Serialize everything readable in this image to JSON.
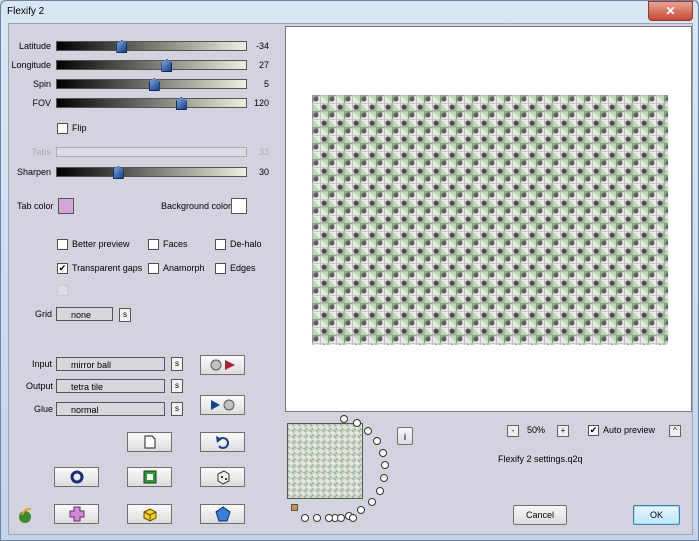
{
  "window": {
    "title": "Flexify 2",
    "close_glyph": "✕"
  },
  "sliders": [
    {
      "label": "Latitude",
      "value": "-34",
      "fraction": 0.33
    },
    {
      "label": "Longitude",
      "value": "27",
      "fraction": 0.58
    },
    {
      "label": "Spin",
      "value": "5",
      "fraction": 0.51
    },
    {
      "label": "FOV",
      "value": "120",
      "fraction": 0.66
    }
  ],
  "flip": {
    "label": "Flip",
    "checked": false
  },
  "tabs": {
    "label": "Tabs",
    "value": "33",
    "disabled": true
  },
  "sharpen": {
    "label": "Sharpen",
    "value": "30",
    "fraction": 0.31
  },
  "tab_color": {
    "label": "Tab color",
    "color": "#d5a6d9"
  },
  "background_color": {
    "label": "Background color",
    "color": "#ffffff"
  },
  "checkboxes": [
    {
      "label": "Better preview",
      "checked": false
    },
    {
      "label": "Faces",
      "checked": false
    },
    {
      "label": "De-halo",
      "checked": false
    },
    {
      "label": "Transparent gaps",
      "checked": true
    },
    {
      "label": "Anamorph",
      "checked": false
    },
    {
      "label": "Edges",
      "checked": false
    }
  ],
  "grid": {
    "label": "Grid",
    "value": "none",
    "s_label": "s"
  },
  "io": {
    "input": {
      "label": "Input",
      "value": "mirror ball",
      "s_label": "s"
    },
    "output": {
      "label": "Output",
      "value": "tetra tile",
      "s_label": "s"
    },
    "glue": {
      "label": "Glue",
      "value": "normal",
      "s_label": "s"
    }
  },
  "zoom": {
    "minus": "-",
    "value": "50%",
    "plus": "+"
  },
  "auto_preview": {
    "label": "Auto preview",
    "checked": true,
    "caret": "^"
  },
  "settings_file": "Flexify 2 settings.q2q",
  "buttons": {
    "cancel": "Cancel",
    "ok": "OK",
    "info": "i"
  }
}
